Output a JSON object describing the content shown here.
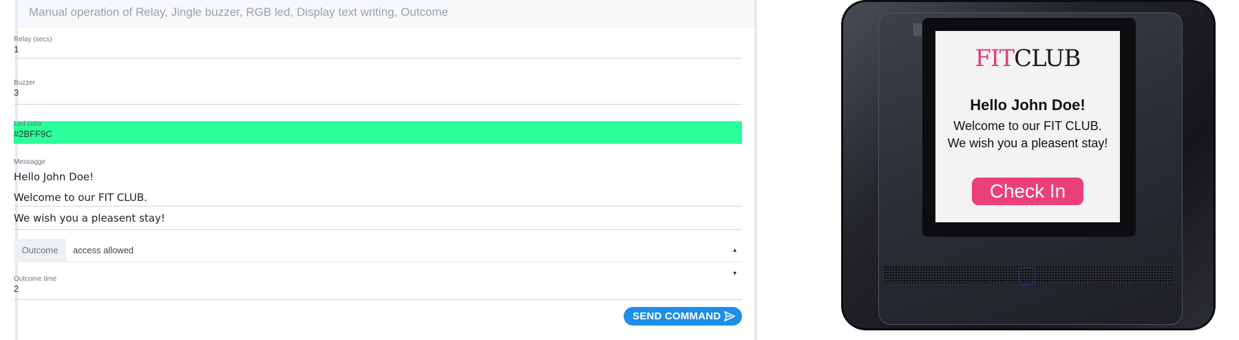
{
  "header": {
    "title": "Manual operation of Relay, Jingle buzzer, RGB led, Display text writing, Outcome"
  },
  "form": {
    "relay": {
      "label": "Relay (secs)",
      "value": "1"
    },
    "buzzer": {
      "label": "Buzzer",
      "value": "3"
    },
    "led": {
      "label": "Led color",
      "value": "#2BFF9C",
      "color": "#2BFF9C"
    },
    "message": {
      "label": "Messagge",
      "lines": [
        "Hello John Doe!",
        "Welcome to our FIT CLUB.",
        "We wish you a pleasent stay!"
      ]
    },
    "outcome": {
      "label": "Outcome",
      "value": "access allowed"
    },
    "outcome_time": {
      "label": "Outcome time",
      "value": "2"
    },
    "send_label": "SEND COMMAND",
    "send_icon": "send-icon"
  },
  "device": {
    "logo_fit": "FIT",
    "logo_club": "CLUB",
    "line1": "Hello John Doe!",
    "line2": "Welcome to our FIT CLUB.",
    "line3": "We wish you a pleasent stay!",
    "checkin_label": "Check In"
  },
  "colors": {
    "accent": "#1E8EE8",
    "led": "#2BFF9C",
    "checkin": "#EC3F7C",
    "logo_fit": "#E23B78"
  }
}
